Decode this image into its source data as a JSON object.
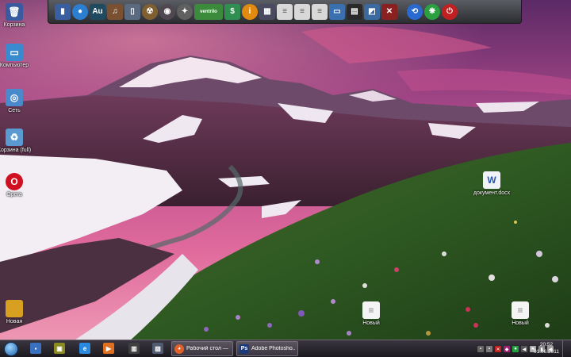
{
  "colors": {
    "sky_top": "#6a2f6e",
    "sky_glow": "#e2689a",
    "dock_bg": "#3a3c41",
    "taskbar_bg": "#2a2630"
  },
  "dock": {
    "items": [
      {
        "icon": "computer-icon",
        "glyph": "▮"
      },
      {
        "icon": "globe-icon",
        "glyph": "●"
      },
      {
        "icon": "audition-icon",
        "glyph": "Au"
      },
      {
        "icon": "media-player-icon",
        "glyph": "♫"
      },
      {
        "icon": "document-viewer-icon",
        "glyph": "▯"
      },
      {
        "icon": "radiation-icon",
        "glyph": "☢"
      },
      {
        "icon": "disc-burner-icon",
        "glyph": "◉"
      },
      {
        "icon": "compass-icon",
        "glyph": "✦"
      },
      {
        "icon": "ventrilo-icon",
        "glyph": "ventrilo"
      },
      {
        "icon": "money-icon",
        "glyph": "$"
      },
      {
        "icon": "info-icon",
        "glyph": "i"
      },
      {
        "icon": "monitor-icon",
        "glyph": "▦"
      },
      {
        "icon": "document-icon",
        "glyph": "≡"
      },
      {
        "icon": "document-icon",
        "glyph": "≡"
      },
      {
        "icon": "document-icon",
        "glyph": "≡"
      },
      {
        "icon": "laptop-icon",
        "glyph": "▭"
      },
      {
        "icon": "calculator-icon",
        "glyph": "▤"
      },
      {
        "icon": "display-settings-icon",
        "glyph": "◩"
      },
      {
        "icon": "tools-icon",
        "glyph": "✕"
      },
      {
        "icon": "logoff-icon",
        "glyph": "⟲"
      },
      {
        "icon": "restart-icon",
        "glyph": "❋"
      },
      {
        "icon": "power-icon",
        "glyph": "⏻"
      }
    ]
  },
  "desktop": {
    "icons": [
      {
        "name": "trash-icon",
        "label": "Корзина",
        "glyph": "🗑"
      },
      {
        "name": "computer-icon",
        "label": "Компьютер",
        "glyph": "▭"
      },
      {
        "name": "network-icon",
        "label": "Сеть",
        "glyph": "◎"
      },
      {
        "name": "recycle-full-icon",
        "label": "Корзина (full)",
        "glyph": "♻"
      },
      {
        "name": "opera-icon",
        "label": "Opera",
        "glyph": "O"
      },
      {
        "name": "word-document-icon",
        "label": "документ.docx",
        "glyph": "W"
      },
      {
        "name": "folder-icon",
        "label": "Новая",
        "glyph": ""
      },
      {
        "name": "text-file-icon",
        "label": "Новый",
        "glyph": "≡"
      },
      {
        "name": "text-file-icon",
        "label": "Новый",
        "glyph": "≡"
      }
    ]
  },
  "taskbar": {
    "pinned": [
      {
        "icon": "save-icon",
        "glyph": "▪"
      },
      {
        "icon": "utility-icon",
        "glyph": "▣"
      },
      {
        "icon": "internet-explorer-icon",
        "glyph": "e"
      },
      {
        "icon": "media-icon",
        "glyph": "▶"
      },
      {
        "icon": "film-icon",
        "glyph": "▥"
      },
      {
        "icon": "network-tray-icon",
        "glyph": "▧"
      }
    ],
    "tasks": [
      {
        "icon": "firefox-icon",
        "glyph": "◕",
        "label": "Рабочий стол —"
      },
      {
        "icon": "photoshop-icon",
        "glyph": "Ps",
        "label": "Adobe Photosho..."
      }
    ],
    "tray": [
      {
        "icon": "keyboard-icon",
        "glyph": "▪"
      },
      {
        "icon": "network-status-icon",
        "glyph": "▪"
      },
      {
        "icon": "antivirus-icon",
        "glyph": "✕"
      },
      {
        "icon": "app-tray-icon",
        "glyph": "◆"
      },
      {
        "icon": "shield-icon",
        "glyph": "●"
      },
      {
        "icon": "arrow-tray-icon",
        "glyph": "◀"
      },
      {
        "icon": "flag-icon",
        "glyph": "⚑"
      },
      {
        "icon": "signal-icon",
        "glyph": "▮"
      },
      {
        "icon": "volume-icon",
        "glyph": "◀"
      }
    ],
    "clock_time": "20:52",
    "clock_date": "01.06.2011"
  }
}
